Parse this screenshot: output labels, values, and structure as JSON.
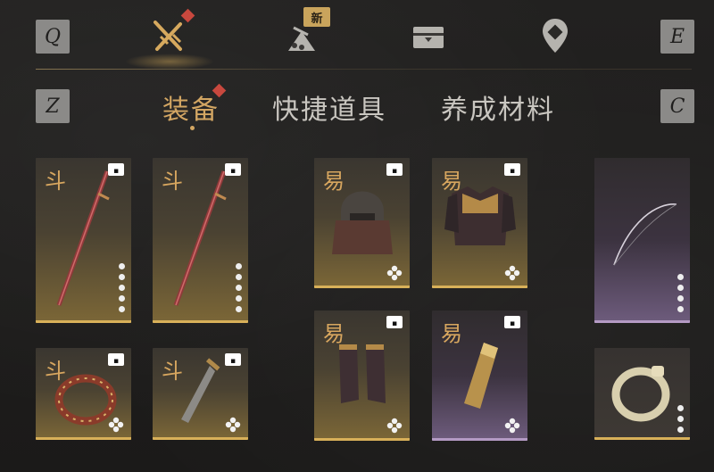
{
  "keys": {
    "q": "Q",
    "e": "E",
    "z": "Z",
    "c": "C"
  },
  "top_tabs": [
    {
      "name": "weapons",
      "icon": "crossed-swords-icon",
      "active": true,
      "red_dot": true
    },
    {
      "name": "bundle",
      "icon": "bundle-sack-icon",
      "badge": "新"
    },
    {
      "name": "chest",
      "icon": "chest-icon"
    },
    {
      "name": "map-pin",
      "icon": "location-pin-icon"
    }
  ],
  "sub_tabs": [
    {
      "label": "装备",
      "active": true,
      "red_dot": true
    },
    {
      "label": "快捷道具",
      "active": false
    },
    {
      "label": "养成材料",
      "active": false
    }
  ],
  "items": [
    {
      "id": "sword-1",
      "glyph": "斗",
      "icon": "red-sword-icon",
      "rarity": "gold",
      "dots": 5
    },
    {
      "id": "sword-2",
      "glyph": "斗",
      "icon": "red-sword-icon",
      "rarity": "gold",
      "dots": 5
    },
    {
      "id": "helmet",
      "glyph": "易",
      "icon": "helmet-icon",
      "rarity": "gold"
    },
    {
      "id": "chest-armor",
      "glyph": "易",
      "icon": "chest-armor-icon",
      "rarity": "gold"
    },
    {
      "id": "bow",
      "icon": "bow-icon",
      "rarity": "purple",
      "dots": 4
    },
    {
      "id": "bracelet",
      "glyph": "斗",
      "icon": "spiked-bracelet-icon",
      "rarity": "gold"
    },
    {
      "id": "dagger",
      "glyph": "斗",
      "icon": "dagger-icon",
      "rarity": "gold"
    },
    {
      "id": "boots",
      "glyph": "易",
      "icon": "boots-icon",
      "rarity": "gold"
    },
    {
      "id": "gauntlet",
      "glyph": "易",
      "icon": "gauntlet-icon",
      "rarity": "purple"
    },
    {
      "id": "ring",
      "icon": "ring-icon",
      "rarity": "gold",
      "dots": 3
    }
  ],
  "colors": {
    "accent": "#d3a663",
    "gold_bar": "#d8b059",
    "purple_bar": "#b49ac4",
    "red_dot": "#c8483e"
  }
}
